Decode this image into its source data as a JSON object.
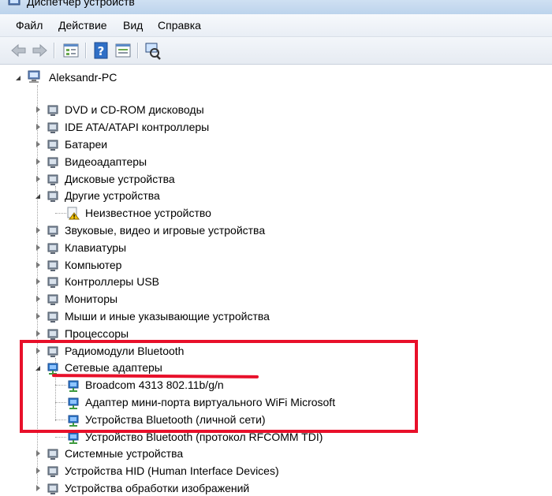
{
  "window": {
    "title": "Диспетчер устройств"
  },
  "menu": [
    "Файл",
    "Действие",
    "Вид",
    "Справка"
  ],
  "toolbar": [
    {
      "icon": "back-arrow-icon"
    },
    {
      "icon": "forward-arrow-icon"
    },
    {
      "icon": "properties-grid-icon"
    },
    {
      "icon": "help-icon"
    },
    {
      "icon": "console-tree-icon"
    },
    {
      "icon": "scan-hardware-icon"
    }
  ],
  "tree": {
    "root": "Aleksandr-PC",
    "items": [
      {
        "label": "DVD и CD-ROM дисководы",
        "icon": "dvd-drive-icon"
      },
      {
        "label": "IDE ATA/ATAPI контроллеры",
        "icon": "ide-controller-icon"
      },
      {
        "label": "Батареи",
        "icon": "battery-icon"
      },
      {
        "label": "Видеоадаптеры",
        "icon": "display-adapter-icon"
      },
      {
        "label": "Дисковые устройства",
        "icon": "disk-drive-icon"
      },
      {
        "label": "Другие устройства",
        "icon": "other-devices-icon",
        "expanded": true
      },
      {
        "label": "Неизвестное устройство",
        "icon": "unknown-device-warning-icon",
        "child": true
      },
      {
        "label": "Звуковые, видео и игровые устройства",
        "icon": "speaker-icon"
      },
      {
        "label": "Клавиатуры",
        "icon": "keyboard-icon"
      },
      {
        "label": "Компьютер",
        "icon": "computer-icon"
      },
      {
        "label": "Контроллеры USB",
        "icon": "usb-icon"
      },
      {
        "label": "Мониторы",
        "icon": "monitor-icon"
      },
      {
        "label": "Мыши и иные указывающие устройства",
        "icon": "mouse-icon"
      },
      {
        "label": "Процессоры",
        "icon": "processor-icon"
      },
      {
        "label": "Радиомодули Bluetooth",
        "icon": "bluetooth-icon"
      },
      {
        "label": "Сетевые адаптеры",
        "icon": "network-adapter-icon",
        "expanded": true
      },
      {
        "label": "Broadcom 4313 802.11b/g/n",
        "icon": "network-card-icon",
        "child": true
      },
      {
        "label": "Адаптер мини-порта виртуального WiFi Microsoft",
        "icon": "network-card-icon",
        "child": true
      },
      {
        "label": "Устройства Bluetooth (личной сети)",
        "icon": "network-card-icon",
        "child": true
      },
      {
        "label": "Устройство Bluetooth (протокол RFCOMM TDI)",
        "icon": "network-card-icon",
        "child": true
      },
      {
        "label": "Системные устройства",
        "icon": "system-devices-icon"
      },
      {
        "label": "Устройства HID (Human Interface Devices)",
        "icon": "hid-icon"
      },
      {
        "label": "Устройства обработки изображений",
        "icon": "imaging-icon"
      }
    ]
  },
  "colors": {
    "highlight": "#e8102a",
    "titlebar": "#c5d8ee"
  }
}
